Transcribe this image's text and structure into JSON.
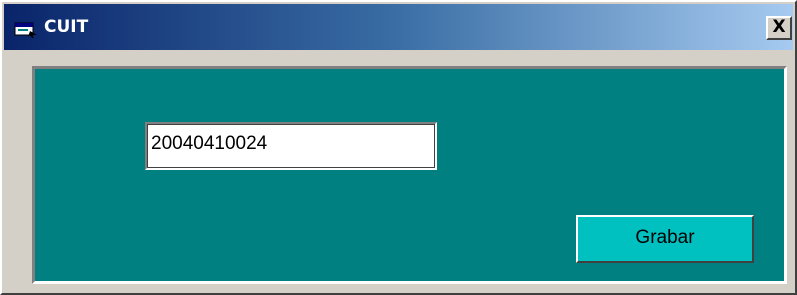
{
  "window": {
    "title": "CUIT",
    "icon": "form-window-icon",
    "close_label": "X"
  },
  "form": {
    "cuit_value": "20040410024",
    "save_label": "Grabar",
    "background_color": "#008080",
    "button_color": "#00c0c0"
  }
}
